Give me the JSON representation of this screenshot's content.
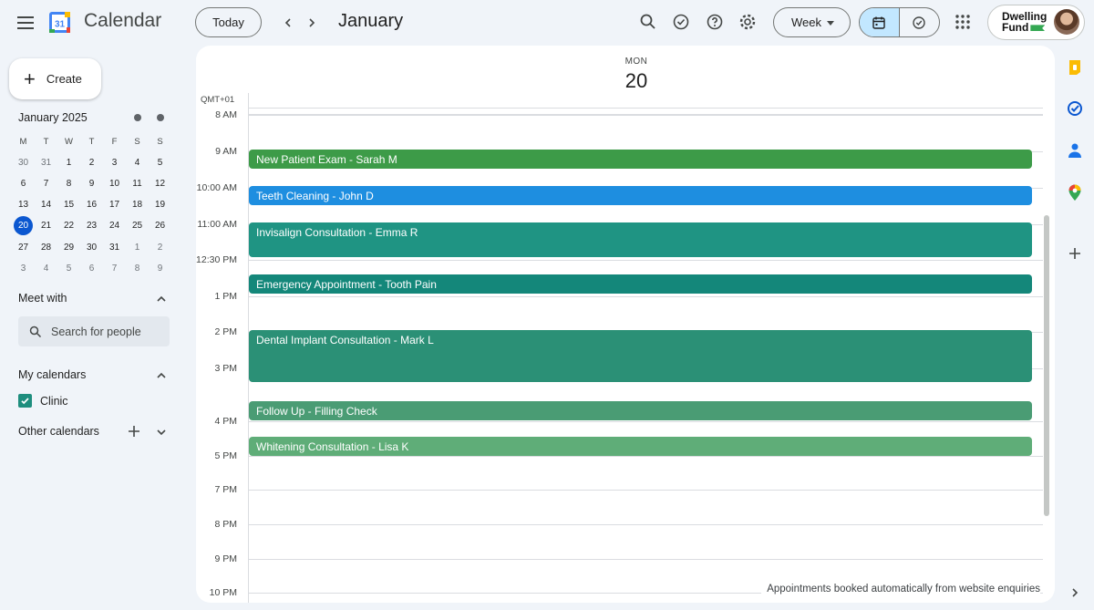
{
  "app": {
    "title": "Calendar",
    "logo_number": "31"
  },
  "header": {
    "today_label": "Today",
    "month": "January",
    "view_label": "Week",
    "account_brand_line1": "Dwelling",
    "account_brand_line2": "Fund"
  },
  "sidebar": {
    "create_label": "Create",
    "mini_calendar": {
      "title": "January 2025",
      "weekdays": [
        "M",
        "T",
        "W",
        "T",
        "F",
        "S",
        "S"
      ],
      "weeks": [
        [
          "30",
          "31",
          "1",
          "2",
          "3",
          "4",
          "5"
        ],
        [
          "6",
          "7",
          "8",
          "9",
          "10",
          "11",
          "12"
        ],
        [
          "13",
          "14",
          "15",
          "16",
          "17",
          "18",
          "19"
        ],
        [
          "20",
          "21",
          "22",
          "23",
          "24",
          "25",
          "26"
        ],
        [
          "27",
          "28",
          "29",
          "30",
          "31",
          "1",
          "2"
        ],
        [
          "3",
          "4",
          "5",
          "6",
          "7",
          "8",
          "9"
        ]
      ],
      "selected": "20"
    },
    "meet_with_title": "Meet with",
    "search_people_placeholder": "Search for people",
    "my_calendars_title": "My calendars",
    "my_calendars": [
      {
        "label": "Clinic",
        "checked": true,
        "color": "#1e8e7e"
      }
    ],
    "other_calendars_title": "Other calendars"
  },
  "day_view": {
    "weekday": "MON",
    "date": "20",
    "timezone": "QMT+01",
    "hours": [
      "8 AM",
      "9 AM",
      "10:00 AM",
      "11:00 AM",
      "12:30 PM",
      "1 PM",
      "2 PM",
      "3 PM",
      "4 PM",
      "5 PM",
      "7 PM",
      "8 PM",
      "9 PM",
      "10 PM"
    ],
    "events": [
      {
        "title": "New Patient Exam - Sarah M",
        "color": "#3d9b48"
      },
      {
        "title": "Teeth Cleaning - John D",
        "color": "#1e8ee0"
      },
      {
        "title": "Invisalign Consultation - Emma R",
        "color": "#1f9483"
      },
      {
        "title": "Emergency Appointment - Tooth Pain",
        "color": "#14877a"
      },
      {
        "title": "Dental Implant Consultation - Mark L",
        "color": "#2b9076"
      },
      {
        "title": "Follow Up - Filling Check",
        "color": "#4a9c74"
      },
      {
        "title": "Whitening Consultation - Lisa K",
        "color": "#5fad78"
      }
    ],
    "footnote": "Appointments booked automatically from website enquiries"
  },
  "colors": {
    "accent": "#0b57d0",
    "selected_view": "#c2e7ff"
  },
  "icons": {
    "header": [
      "menu-icon",
      "search-icon",
      "task-check-icon",
      "help-icon",
      "settings-icon",
      "calendar-view-icon",
      "tasks-view-icon",
      "apps-grid-icon"
    ],
    "rail": [
      "keep-icon",
      "tasks-icon",
      "contacts-icon",
      "maps-icon",
      "add-icon",
      "expand-icon"
    ]
  }
}
